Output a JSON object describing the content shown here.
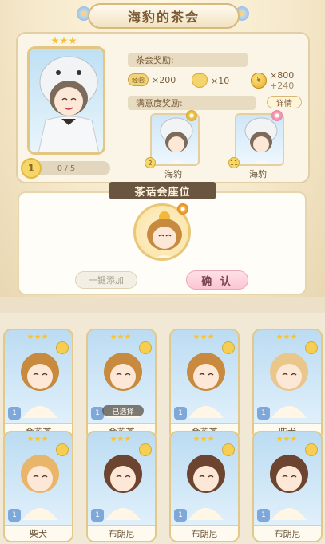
{
  "header": {
    "title": "海豹的茶会"
  },
  "hero": {
    "stars": 3,
    "level": "1",
    "progress_text": "0 / 5",
    "progress": 0.0
  },
  "rewards": {
    "tea_label": "茶会奖励:",
    "exp_chip": "经验",
    "exp_value": "×200",
    "heart_value": "×10",
    "coin_value": "×800",
    "coin_bonus": "+240"
  },
  "satisfaction": {
    "label": "满意度奖励:",
    "detail_button": "详情",
    "items": [
      {
        "level": "2",
        "name": "海豹"
      },
      {
        "level": "11",
        "name": "海豹"
      }
    ]
  },
  "seat": {
    "title": "茶话会座位",
    "add_all_button": "一键添加",
    "confirm_button": "确 认"
  },
  "cards": [
    {
      "name": "金花茶",
      "level": "1",
      "stars": 3,
      "selected": false,
      "hair": "#c88a3e"
    },
    {
      "name": "金花茶",
      "level": "1",
      "stars": 3,
      "selected": true,
      "selected_label": "已选择",
      "hair": "#c88a3e"
    },
    {
      "name": "金花茶",
      "level": "1",
      "stars": 3,
      "selected": false,
      "hair": "#c88a3e"
    },
    {
      "name": "柴犬",
      "level": "1",
      "stars": 3,
      "selected": false,
      "hair": "#e9c78a"
    },
    {
      "name": "柴犬",
      "level": "1",
      "stars": 3,
      "selected": false,
      "hair": "#e9b56a"
    },
    {
      "name": "布朗尼",
      "level": "1",
      "stars": 3,
      "selected": false,
      "hair": "#6d4430"
    },
    {
      "name": "布朗尼",
      "level": "1",
      "stars": 3,
      "selected": false,
      "hair": "#6d4430"
    },
    {
      "name": "布朗尼",
      "level": "1",
      "stars": 3,
      "selected": false,
      "hair": "#6d4430"
    }
  ]
}
